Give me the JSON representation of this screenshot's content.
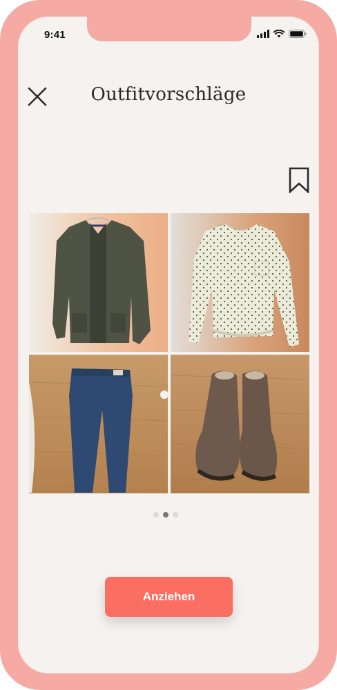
{
  "status_bar": {
    "time": "9:41"
  },
  "header": {
    "title": "Outfitvorschläge"
  },
  "outfit": {
    "items": [
      {
        "name": "cardigan"
      },
      {
        "name": "blouse"
      },
      {
        "name": "jeans"
      },
      {
        "name": "boots"
      }
    ]
  },
  "pagination": {
    "count": 3,
    "active_index": 1
  },
  "cta": {
    "label": "Anziehen"
  },
  "colors": {
    "frame": "#f5aba3",
    "background": "#f5f2ef",
    "accent": "#fa6f62"
  },
  "icons": [
    "close-icon",
    "bookmark-icon",
    "signal-icon",
    "wifi-icon",
    "battery-icon"
  ]
}
